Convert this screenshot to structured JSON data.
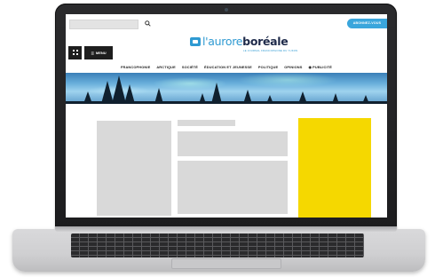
{
  "website": {
    "search": {
      "placeholder": "",
      "icon": "search-icon"
    },
    "subscribe_label": "ABONNEZ-VOUS",
    "grid_icon": "grid-icon",
    "menu_label": "MENU",
    "menu_icon": "hamburger-icon",
    "logo": {
      "part1": "l'aurore",
      "part2": "boréale",
      "tagline": "LE JOURNAL FRANCOPHONE DU YUKON"
    },
    "nav": [
      {
        "label": "FRANCOPHONIE"
      },
      {
        "label": "ARCTIQUE"
      },
      {
        "label": "SOCIÉTÉ"
      },
      {
        "label": "ÉDUCATION ET JEUNESSE"
      },
      {
        "label": "POLITIQUE"
      },
      {
        "label": "OPINIONS"
      },
      {
        "label": "PUBLICITÉ",
        "icon": "megaphone-icon"
      }
    ],
    "colors": {
      "brand_blue": "#2f9ad2",
      "brand_dark": "#1e2a4a",
      "ad_yellow": "#f5d800"
    }
  }
}
